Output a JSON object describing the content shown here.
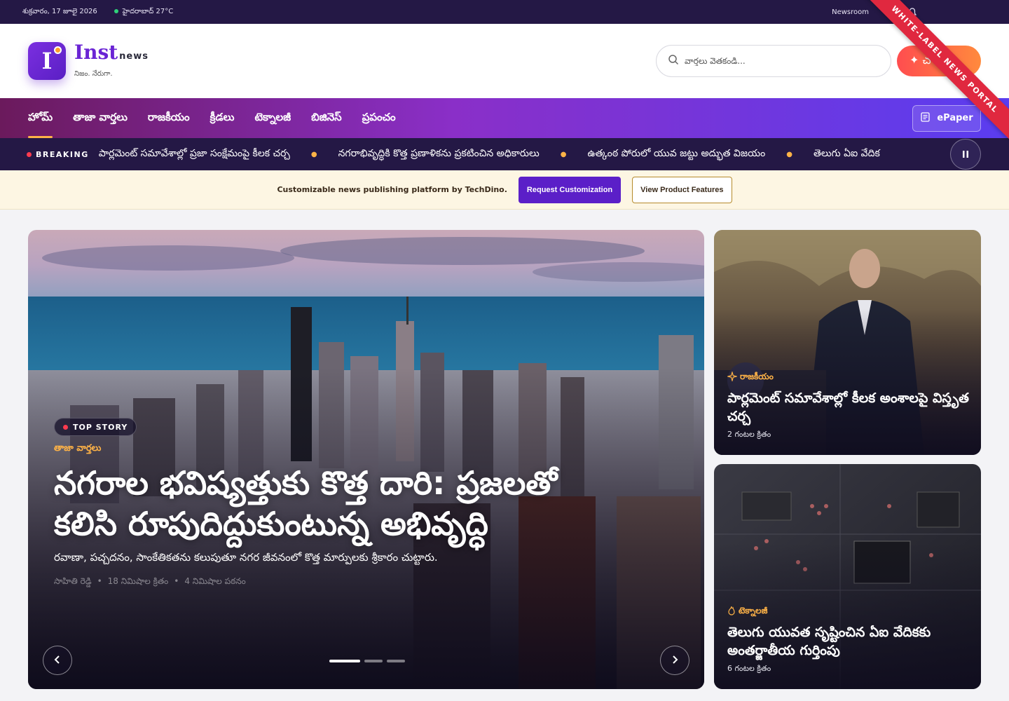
{
  "topbar": {
    "date": "శుక్రవారం, 17 జూలై 2026",
    "weather": "హైదరాబాద్ 27°C",
    "newsroom": "Newsroom"
  },
  "header": {
    "logo_letter": "I",
    "brand_name": "Inst",
    "brand_suffix": "news",
    "tagline": "నిజం. నేరుగా.",
    "search_placeholder": "వార్తలు వెతకండి...",
    "cta_label": "✦ చ"
  },
  "ribbon": {
    "label": "WHITE-LABEL NEWS PORTAL"
  },
  "nav": {
    "items": [
      "హోమ్",
      "తాజా వార్తలు",
      "రాజకీయం",
      "క్రీడలు",
      "టెక్నాలజీ",
      "బిజినెస్",
      "ప్రపంచం"
    ],
    "epaper_label": "ePaper"
  },
  "breaking": {
    "label": "BREAKING",
    "items": [
      "పార్లమెంట్ సమావేశాల్లో ప్రజా సంక్షేమంపై కీలక చర్చ",
      "నగరాభివృద్ధికి కొత్త ప్రణాళికను ప్రకటించిన అధికారులు",
      "ఉత్కంఠ పోరులో యువ జట్టు అద్భుత విజయం",
      "తెలుగు ఏఐ వేదిక"
    ]
  },
  "promo": {
    "text": "Customizable news publishing platform by TechDino.",
    "primary": "Request Customization",
    "secondary": "View Product Features"
  },
  "hero": {
    "badge": "TOP STORY",
    "category": "తాజా వార్తలు",
    "title": "నగరాల భవిష్యత్తుకు కొత్త దారి: ప్రజలతో కలిసి రూపుదిద్దుకుంటున్న అభివృద్ధి",
    "subtitle": "రవాణా, పచ్చదనం, సాంకేతికతను కలుపుతూ నగర జీవనంలో కొత్త మార్పులకు శ్రీకారం చుట్టారు.",
    "author": "సాహితి రెడ్డి",
    "time": "18 నిమిషాల క్రితం",
    "read": "4 నిమిషాల పఠనం",
    "slides": 3,
    "active_slide": 1
  },
  "cards": [
    {
      "category": "రాజకీయం",
      "title": "పార్లమెంట్ సమావేశాల్లో కీలక అంశాలపై విస్తృత చర్చ",
      "time": "2 గంటల క్రితం",
      "icon": "sparkle-icon"
    },
    {
      "category": "టెక్నాలజీ",
      "title": "తెలుగు యువత సృష్టించిన ఏఐ వేదికకు అంతర్జాతీయ గుర్తింపు",
      "time": "6 గంటల క్రితం",
      "icon": "flame-icon"
    }
  ],
  "colors": {
    "brand": "#6a24d4",
    "accent": "#ffb347",
    "topbar": "#241845",
    "breaking_dot": "#ff3b4f"
  }
}
